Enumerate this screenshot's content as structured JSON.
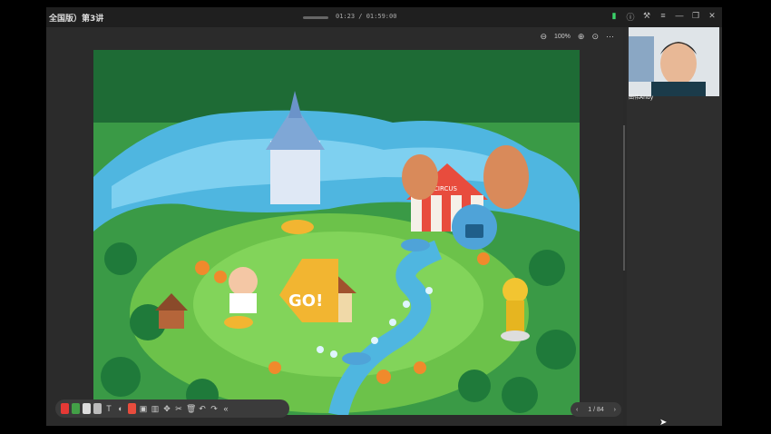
{
  "window": {
    "title": "全国版）第3讲",
    "time": "01:23 / 01:59:00",
    "titlebar_icons": [
      "signal-icon",
      "info-icon",
      "tools-icon",
      "menu-icon",
      "minimize-icon",
      "restore-icon",
      "close-icon"
    ]
  },
  "zoom": {
    "level": "100%"
  },
  "pager": {
    "prev": "‹",
    "page": "1 / 84",
    "next": "›"
  },
  "teacher": {
    "name": "田伟Andy"
  },
  "toolbar": {
    "colors": {
      "red_pen": "#e53935",
      "green_pen": "#43a047",
      "accent": "#e84c3d"
    },
    "collapse_label": "«"
  },
  "slide": {
    "go_label": "GO!",
    "tent_label": "CIRCUS"
  }
}
